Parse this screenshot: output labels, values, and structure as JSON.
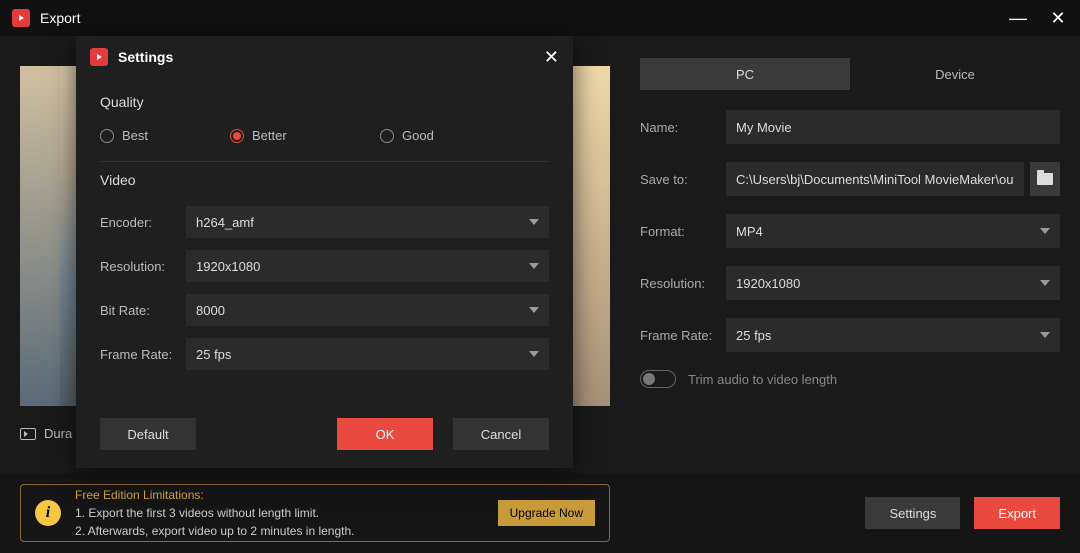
{
  "titlebar": {
    "title": "Export"
  },
  "tabs": {
    "pc": "PC",
    "device": "Device"
  },
  "form": {
    "name_label": "Name:",
    "name_value": "My Movie",
    "saveto_label": "Save to:",
    "saveto_value": "C:\\Users\\bj\\Documents\\MiniTool MovieMaker\\outp",
    "format_label": "Format:",
    "format_value": "MP4",
    "resolution_label": "Resolution:",
    "resolution_value": "1920x1080",
    "framerate_label": "Frame Rate:",
    "framerate_value": "25 fps",
    "trim_label": "Trim audio to video length"
  },
  "duration_label": "Dura",
  "limitations": {
    "title": "Free Edition Limitations:",
    "line1": "1. Export the first 3 videos without length limit.",
    "line2": "2. Afterwards, export video up to 2 minutes in length.",
    "upgrade": "Upgrade Now"
  },
  "footer": {
    "settings": "Settings",
    "export": "Export"
  },
  "modal": {
    "title": "Settings",
    "quality_section": "Quality",
    "opt_best": "Best",
    "opt_better": "Better",
    "opt_good": "Good",
    "video_section": "Video",
    "encoder_label": "Encoder:",
    "encoder_value": "h264_amf",
    "resolution_label": "Resolution:",
    "resolution_value": "1920x1080",
    "bitrate_label": "Bit Rate:",
    "bitrate_value": "8000",
    "framerate_label": "Frame Rate:",
    "framerate_value": "25 fps",
    "default": "Default",
    "ok": "OK",
    "cancel": "Cancel"
  }
}
